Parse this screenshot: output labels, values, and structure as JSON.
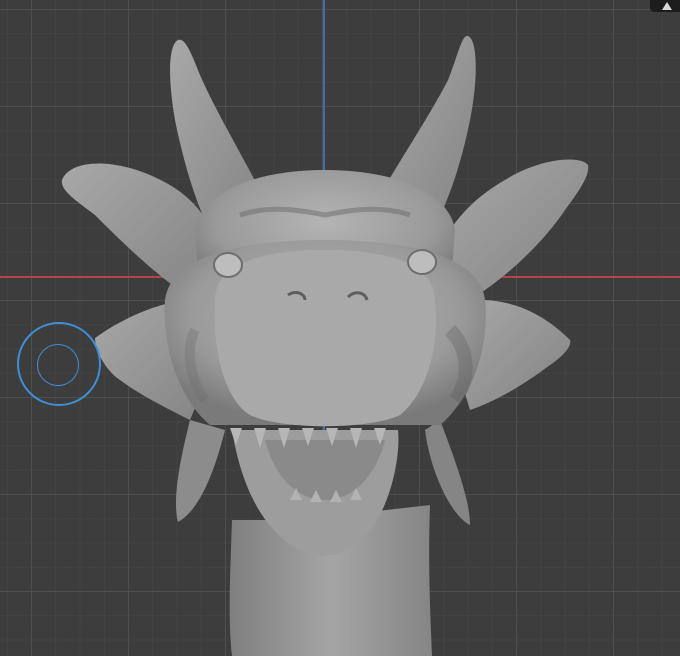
{
  "viewport": {
    "background_color": "#3d3d3d",
    "grid_line_color": "#505050",
    "axis_x_color": "#b3434f",
    "axis_y_color": "#3a6fb0"
  },
  "model": {
    "subject": "dragon-head-sculpt",
    "base_color": "#9a9a9a",
    "shadow_color": "#5a5a5a"
  },
  "brush_cursor": {
    "color": "#3f8ed8"
  },
  "corner_widget": {
    "icon": "navigation-gizmo-icon"
  }
}
